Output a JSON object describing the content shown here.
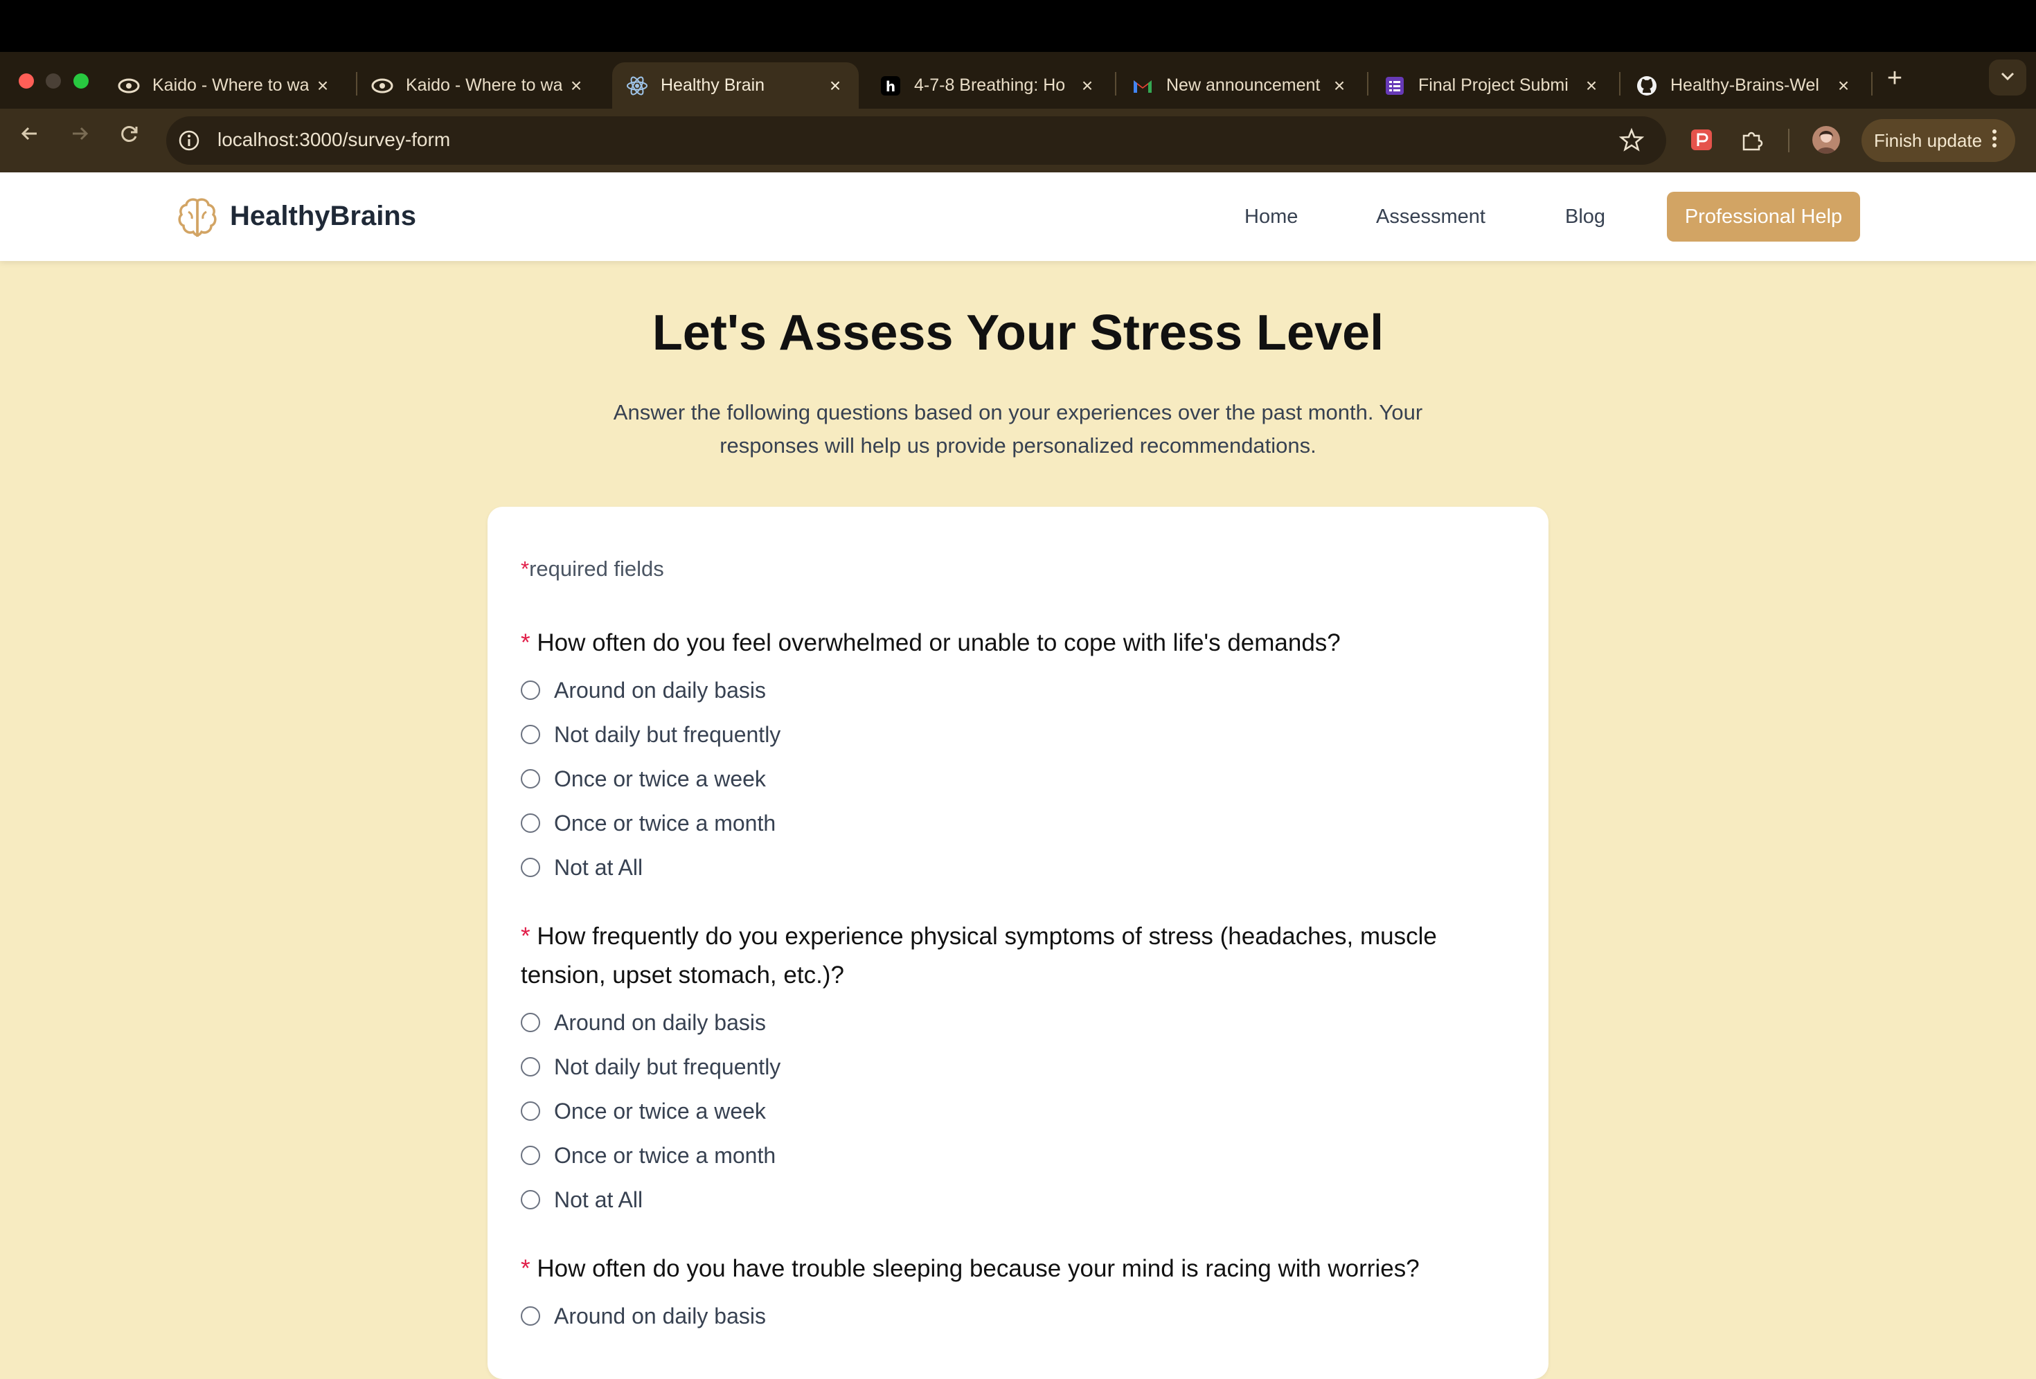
{
  "browser": {
    "tabs": [
      {
        "title": "Kaido - Where to wa",
        "icon": "kaido-icon"
      },
      {
        "title": "Kaido - Where to wa",
        "icon": "kaido-icon"
      },
      {
        "title": "Healthy Brain",
        "icon": "react-icon",
        "active": true
      },
      {
        "title": "4-7-8 Breathing: Ho",
        "icon": "h-icon"
      },
      {
        "title": "New announcement",
        "icon": "gmail-icon"
      },
      {
        "title": "Final Project Submi",
        "icon": "forms-icon"
      },
      {
        "title": "Healthy-Brains-Wel",
        "icon": "github-icon"
      }
    ],
    "new_tab": "+",
    "url": "localhost:3000/survey-form",
    "finish_update": "Finish update"
  },
  "site": {
    "brand": "HealthyBrains",
    "nav": {
      "home": "Home",
      "assessment": "Assessment",
      "blog": "Blog",
      "professional_help": "Professional Help"
    },
    "accent": "#d2a464",
    "background": "#f7ebc1"
  },
  "page": {
    "title": "Let's Assess Your Stress Level",
    "subtitle_line1": "Answer the following questions based on your experiences over the past month. Your",
    "subtitle_line2": "responses will help us provide personalized recommendations."
  },
  "form": {
    "required_star": "*",
    "required_label": "required fields",
    "questions": [
      {
        "text": "How often do you feel overwhelmed or unable to cope with life's demands?",
        "options": [
          "Around on daily basis",
          "Not daily but frequently",
          "Once or twice a week",
          "Once or twice a month",
          "Not at All"
        ]
      },
      {
        "text_line1": "How frequently do you experience physical symptoms of stress (headaches, muscle",
        "text_line2": "tension, upset stomach, etc.)?",
        "options": [
          "Around on daily basis",
          "Not daily but frequently",
          "Once or twice a week",
          "Once or twice a month",
          "Not at All"
        ]
      },
      {
        "text": "How often do you have trouble sleeping because your mind is racing with worries?",
        "options": [
          "Around on daily basis"
        ]
      }
    ]
  }
}
